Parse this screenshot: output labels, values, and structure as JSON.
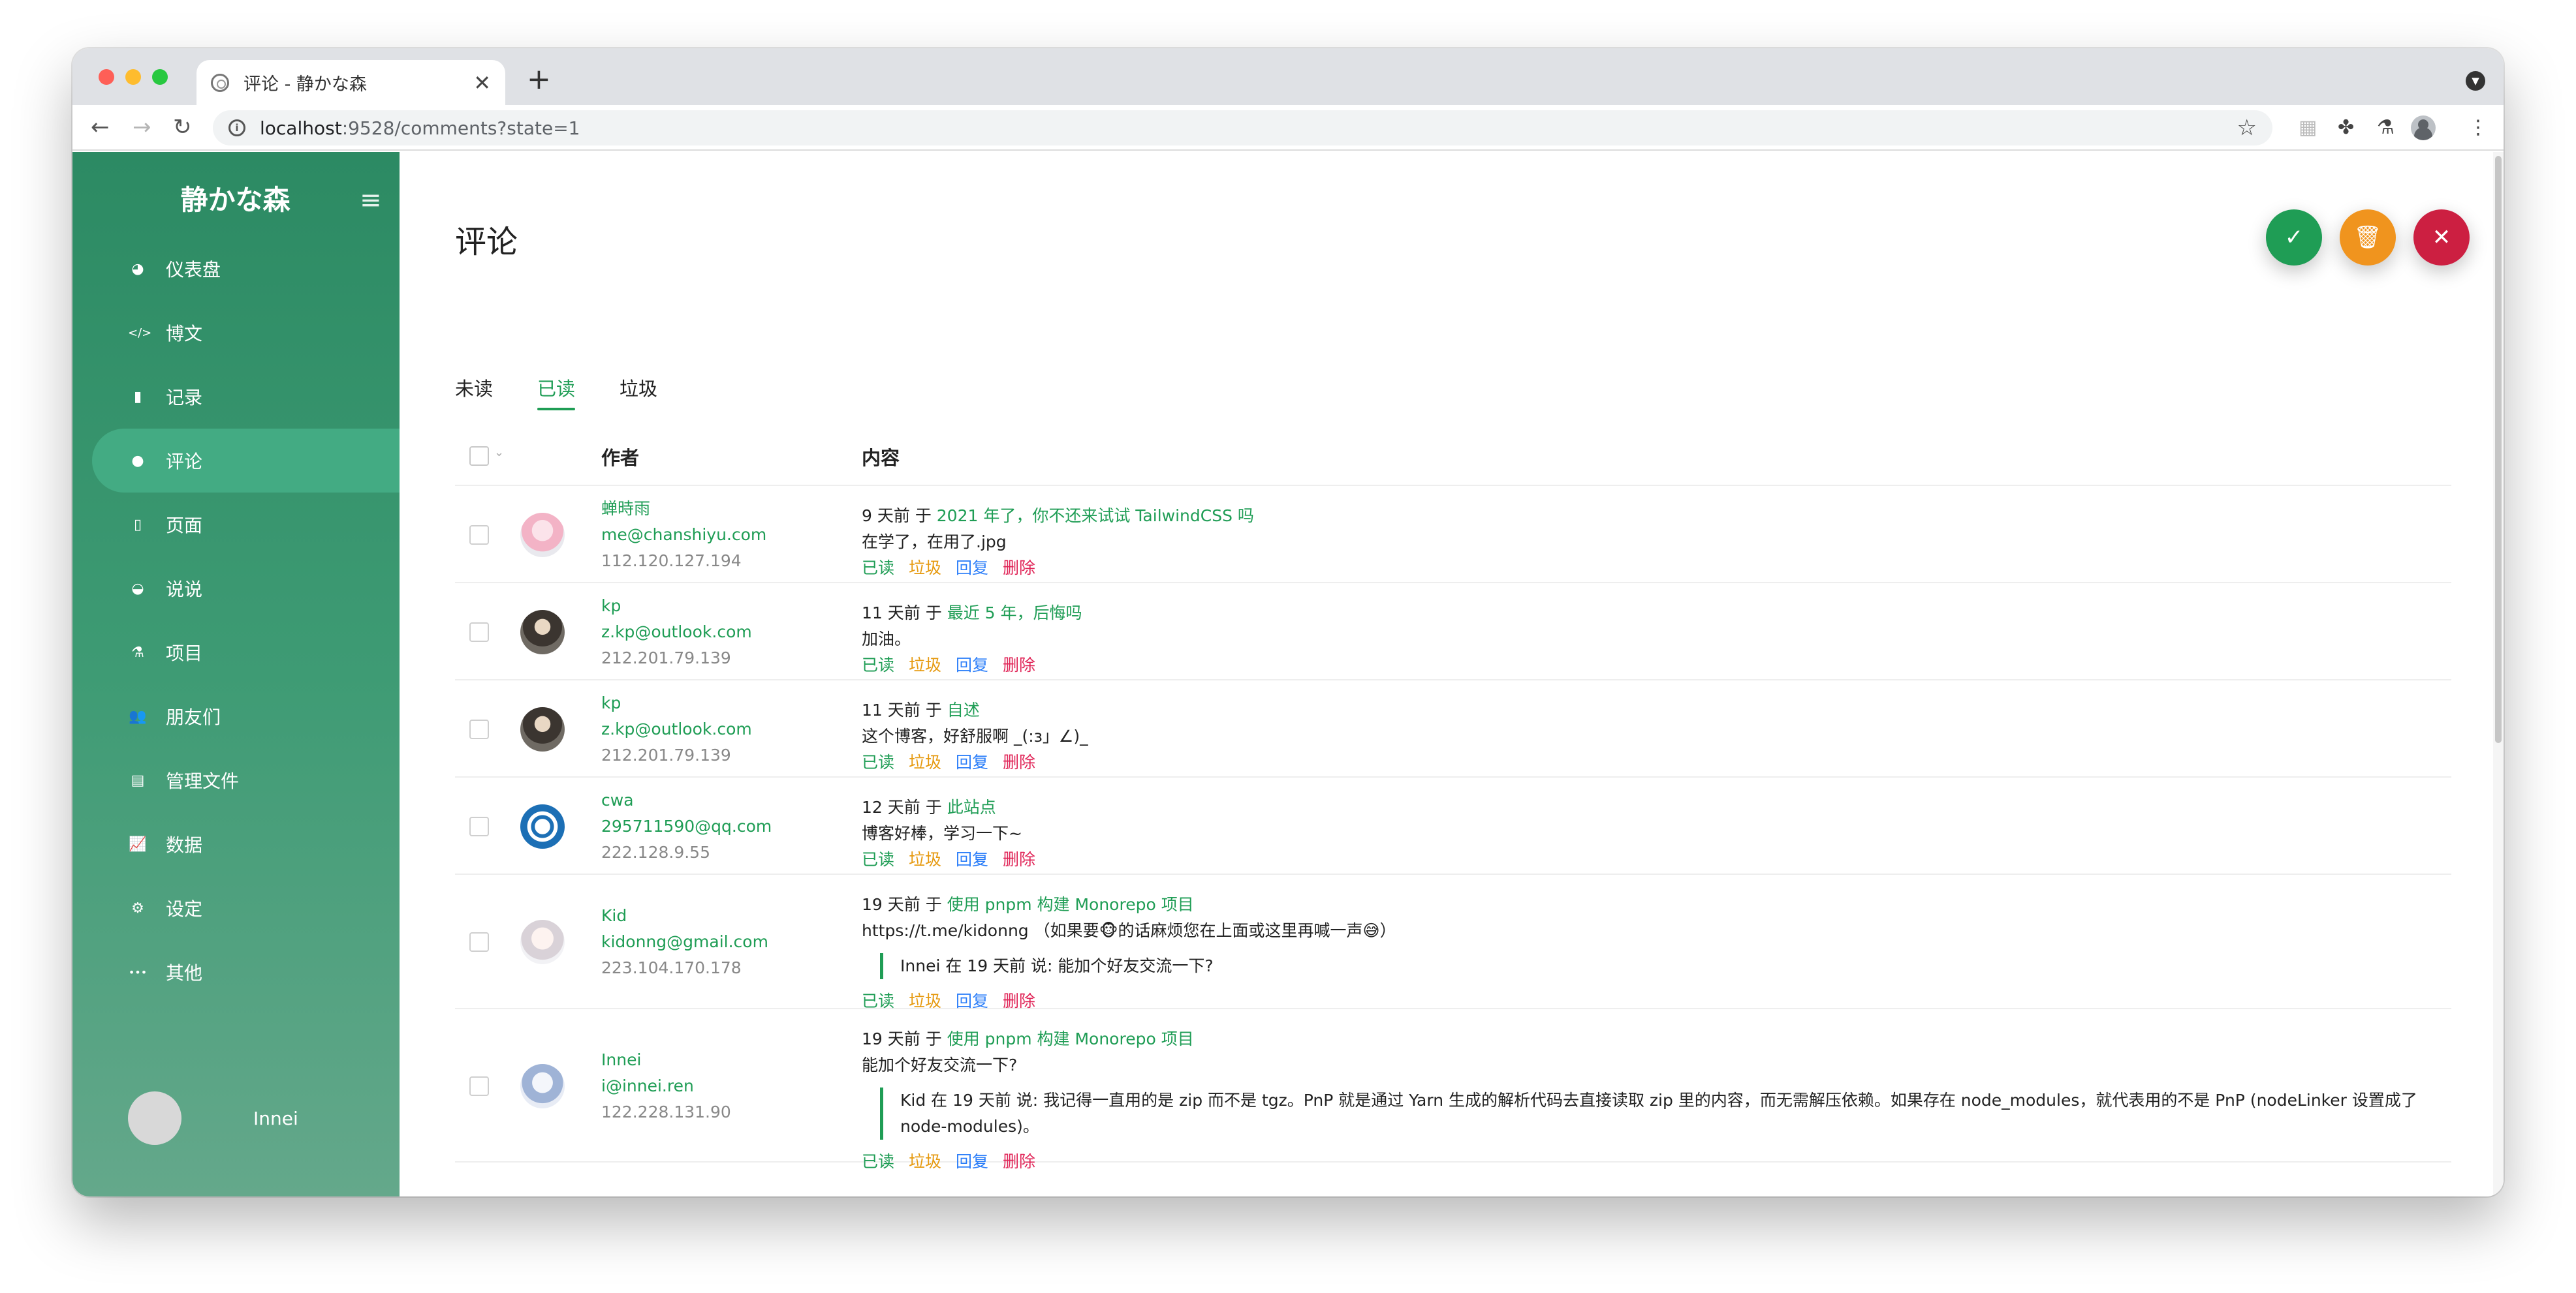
{
  "browser": {
    "tab_title": "评论 - 静かな森",
    "url_host": "localhost",
    "url_rest": ":9528/comments?state=1"
  },
  "sidebar": {
    "brand": "静かな森",
    "items": [
      {
        "label": "仪表盘",
        "icon": "dashboard-icon"
      },
      {
        "label": "博文",
        "icon": "code-icon"
      },
      {
        "label": "记录",
        "icon": "book-icon"
      },
      {
        "label": "评论",
        "icon": "comment-icon",
        "active": true
      },
      {
        "label": "页面",
        "icon": "file-icon"
      },
      {
        "label": "说说",
        "icon": "chat-icon"
      },
      {
        "label": "项目",
        "icon": "flask-icon"
      },
      {
        "label": "朋友们",
        "icon": "users-icon"
      },
      {
        "label": "管理文件",
        "icon": "document-icon"
      },
      {
        "label": "数据",
        "icon": "chart-icon"
      },
      {
        "label": "设定",
        "icon": "gears-icon"
      },
      {
        "label": "其他",
        "icon": "more-icon"
      }
    ],
    "username": "Innei"
  },
  "main": {
    "title": "评论",
    "tabs": [
      {
        "label": "未读"
      },
      {
        "label": "已读",
        "active": true
      },
      {
        "label": "垃圾"
      }
    ],
    "columns": {
      "author": "作者",
      "content": "内容"
    },
    "action_labels": {
      "read": "已读",
      "spam": "垃圾",
      "reply": "回复",
      "delete": "删除"
    },
    "comments": [
      {
        "name": "蝉時雨",
        "email": "me@chanshiyu.com",
        "ip": "112.120.127.194",
        "time": "9 天前",
        "at": "于",
        "post": "2021 年了，你不还来试试 TailwindCSS 吗",
        "text": "在学了，在用了.jpg"
      },
      {
        "name": "kp",
        "email": "z.kp@outlook.com",
        "ip": "212.201.79.139",
        "time": "11 天前",
        "at": "于",
        "post": "最近 5 年，后悔吗",
        "text": "加油。"
      },
      {
        "name": "kp",
        "email": "z.kp@outlook.com",
        "ip": "212.201.79.139",
        "time": "11 天前",
        "at": "于",
        "post": "自述",
        "text": "这个博客，好舒服啊 _(:з」∠)_"
      },
      {
        "name": "cwa",
        "email": "295711590@qq.com",
        "ip": "222.128.9.55",
        "time": "12 天前",
        "at": "于",
        "post": "此站点",
        "text": "博客好棒，学习一下~"
      },
      {
        "name": "Kid",
        "email": "kidonng@gmail.com",
        "ip": "223.104.170.178",
        "time": "19 天前",
        "at": "于",
        "post": "使用 pnpm 构建 Monorepo 项目",
        "text": "https://t.me/kidonng （如果要🐵的话麻烦您在上面或这里再喊一声😅）",
        "quote": "Innei 在 19 天前 说: 能加个好友交流一下?"
      },
      {
        "name": "Innei",
        "email": "i@innei.ren",
        "ip": "122.228.131.90",
        "time": "19 天前",
        "at": "于",
        "post": "使用 pnpm 构建 Monorepo 项目",
        "text": "能加个好友交流一下?",
        "quote": "Kid 在 19 天前 说: 我记得一直用的是 zip 而不是 tgz。PnP 就是通过 Yarn 生成的解析代码去直接读取 zip 里的内容，而无需解压依赖。如果存在 node_modules，就代表用的不是 PnP (nodeLinker 设置成了 node-modules)。"
      }
    ]
  },
  "colors": {
    "accent": "#1f9d55",
    "spam": "#e69a10",
    "reply": "#2d7ff9",
    "delete": "#e02457",
    "fab_confirm": "#1f9d55",
    "fab_trash": "#f0941e",
    "fab_close": "#cc1f41"
  }
}
